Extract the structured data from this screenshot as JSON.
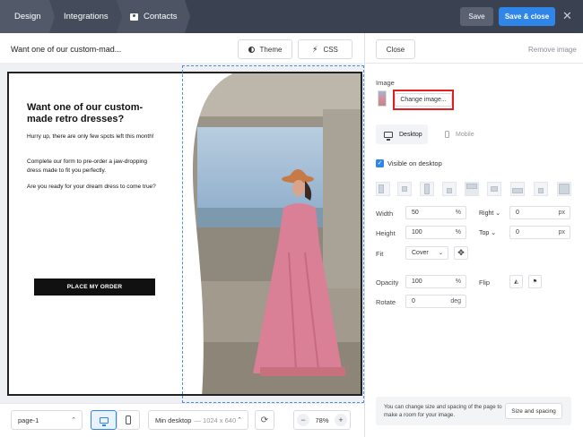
{
  "topbar": {
    "tabs": [
      {
        "label": "Design"
      },
      {
        "label": "Integrations"
      },
      {
        "label": "Contacts",
        "icon": "contact-card-icon"
      }
    ],
    "save_label": "Save",
    "save_close_label": "Save & close",
    "close_icon": "close-icon"
  },
  "editor": {
    "doc_title": "Want one of our custom-mad...",
    "theme_label": "Theme",
    "css_label": "CSS"
  },
  "popup": {
    "headline": "Want one of our custom-made retro dresses?",
    "paragraphs": [
      "Hurry up, there are only few spots left this month!",
      "Complete our form to pre-order a jaw-dropping dress made to fit you perfectly.",
      "Are you ready for your dream dress to come true?"
    ],
    "cta_label": "PLACE MY ORDER",
    "colors": {
      "cta_bg": "#111111",
      "dress": "#d97f96",
      "hat": "#c77a45",
      "sky": "#9ebbd6"
    }
  },
  "bottombar": {
    "page_select": "page-1",
    "size_label": "Min desktop",
    "size_dims": "— 1024 x 640",
    "zoom": "78%",
    "zoom_minus": "−",
    "zoom_plus": "+"
  },
  "panel": {
    "close_label": "Close",
    "remove_label": "Remove image",
    "image_heading": "Image",
    "change_image_label": "Change image...",
    "tab_desktop": "Desktop",
    "tab_mobile": "Mobile",
    "visible_label": "Visible on desktop",
    "visible_checked": true,
    "width_label": "Width",
    "width_value": "50",
    "width_unit": "%",
    "right_label": "Right",
    "right_value": "0",
    "right_unit": "px",
    "height_label": "Height",
    "height_value": "100",
    "height_unit": "%",
    "top_label": "Top",
    "top_value": "0",
    "top_unit": "px",
    "fit_label": "Fit",
    "fit_value": "Cover",
    "opacity_label": "Opacity",
    "opacity_value": "100",
    "opacity_unit": "%",
    "flip_label": "Flip",
    "rotate_label": "Rotate",
    "rotate_value": "0",
    "rotate_unit": "deg",
    "tip_text": "You can change size and spacing of the page to make a room for your image.",
    "tip_button": "Size and spacing",
    "accent": "#2f86e8",
    "highlight": "#e02020"
  }
}
